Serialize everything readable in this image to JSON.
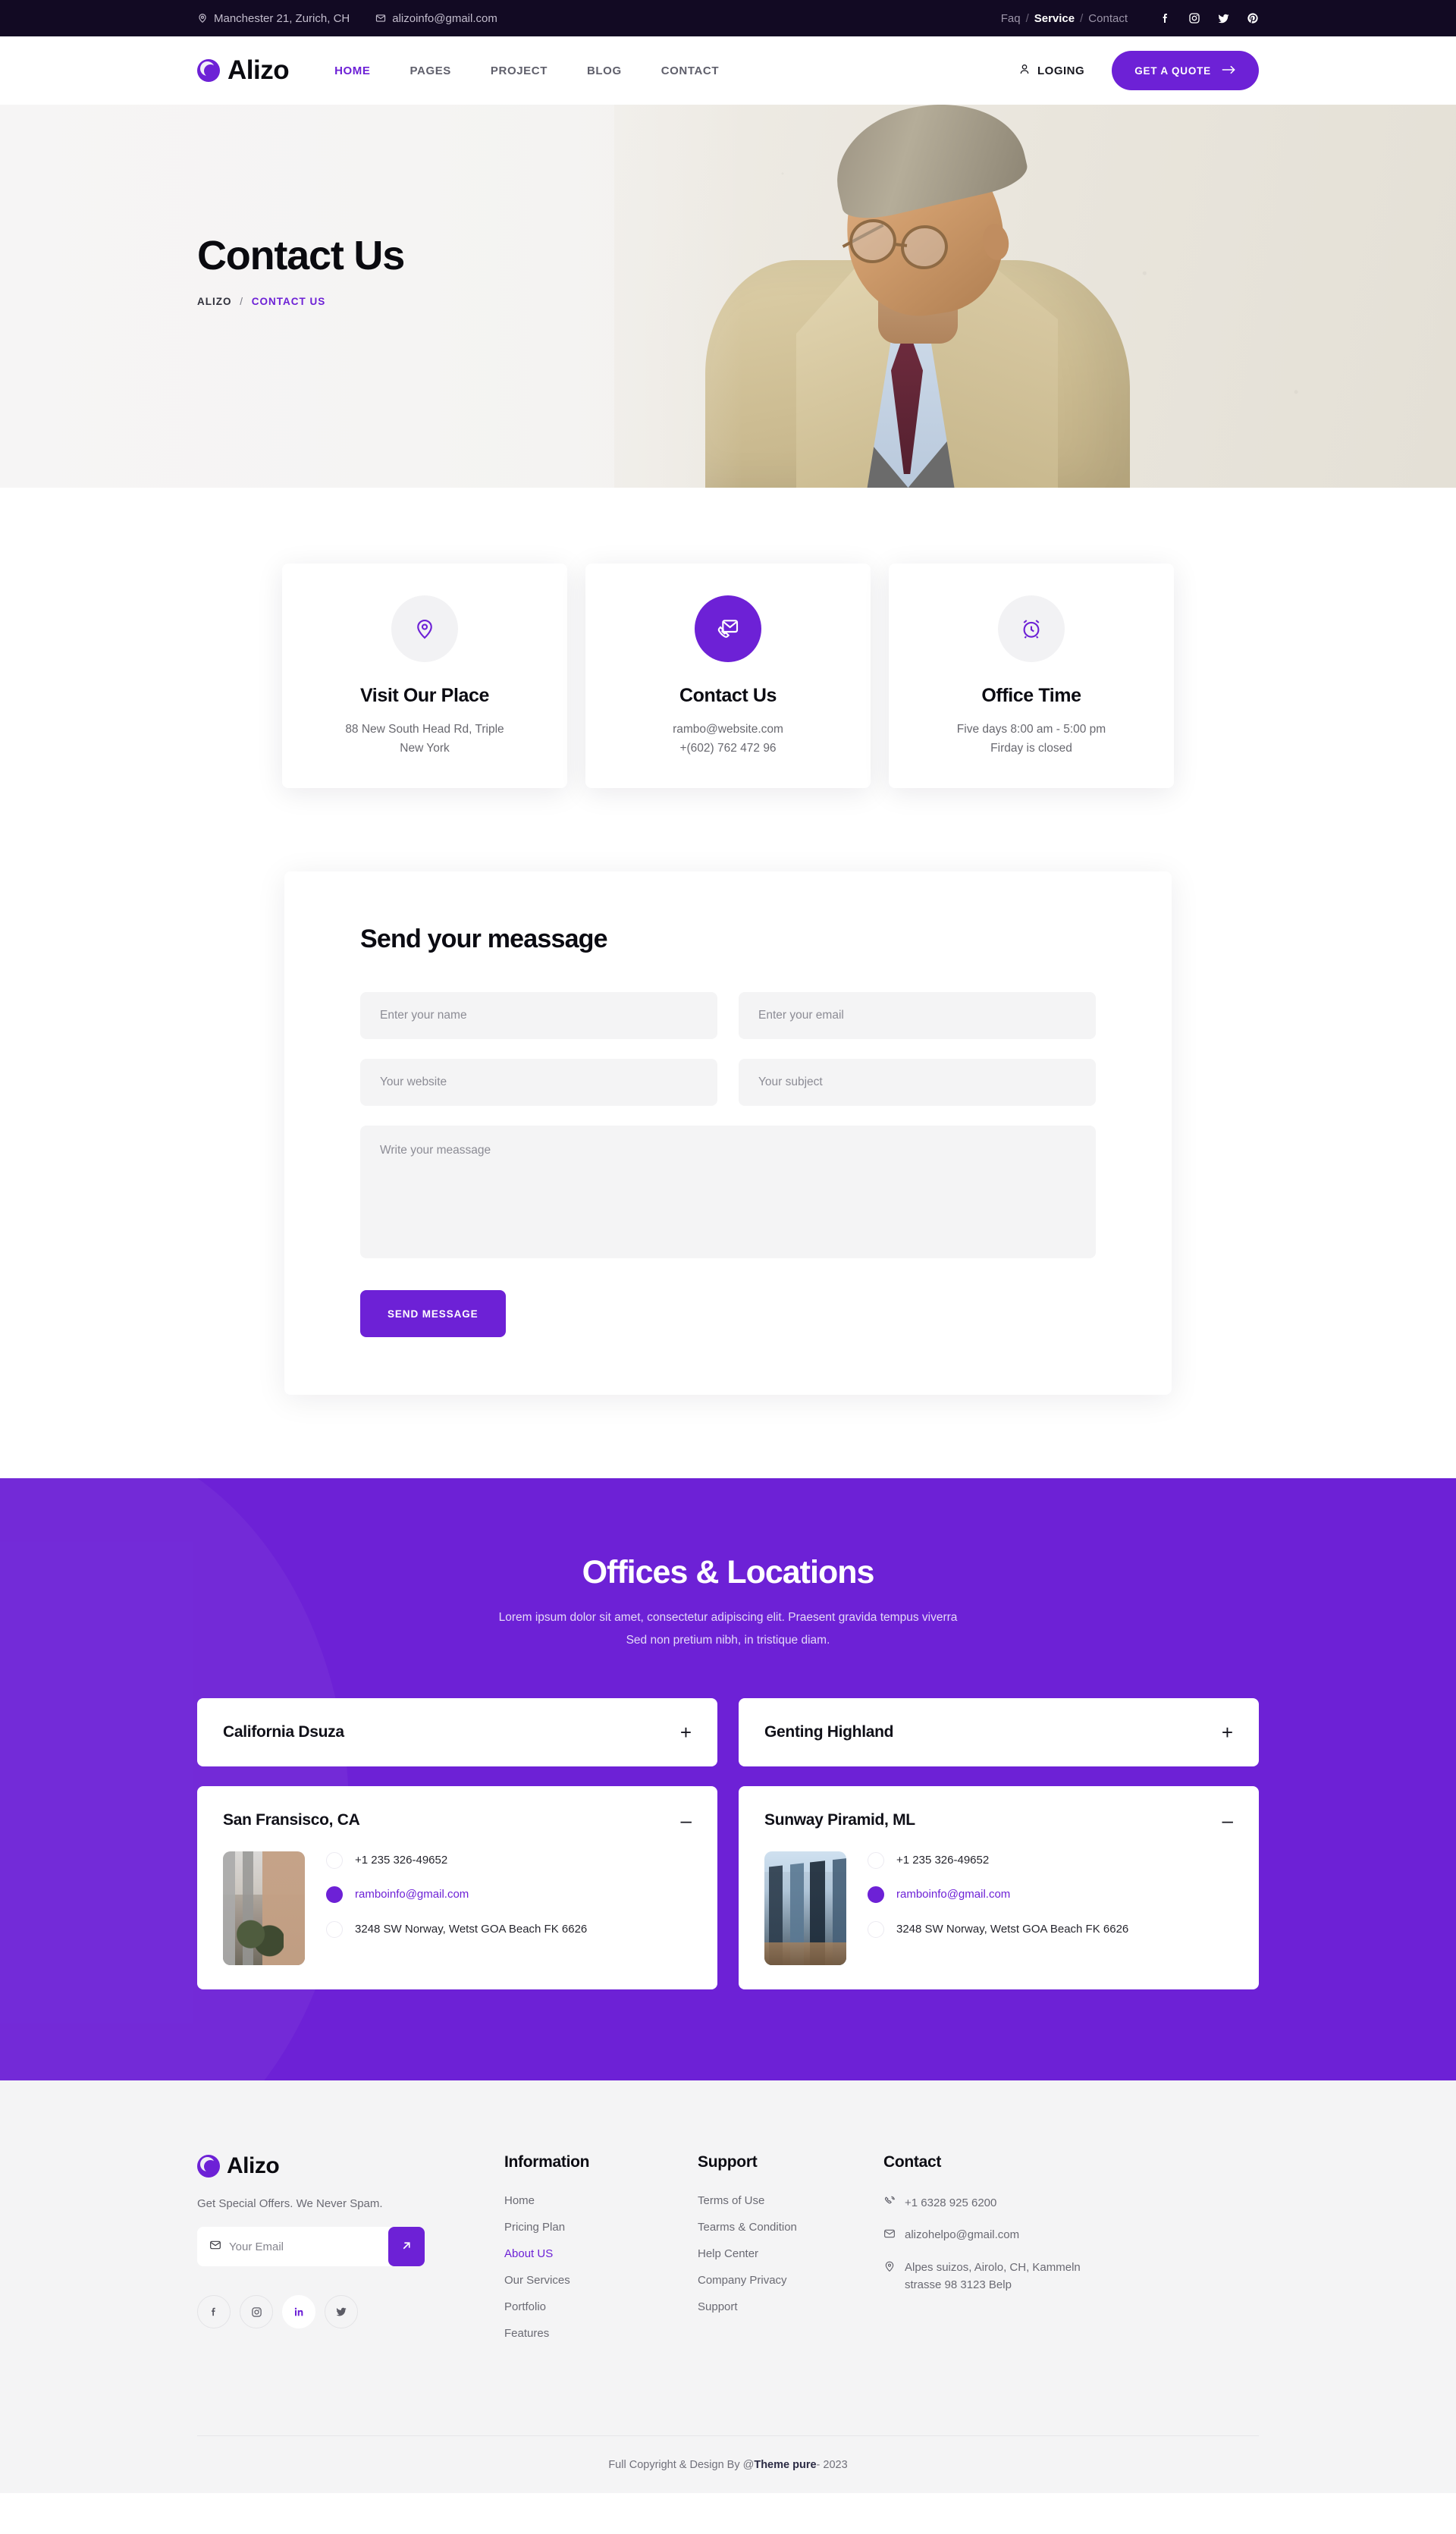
{
  "topbar": {
    "address": "Manchester 21, Zurich, CH",
    "email": "alizoinfo@gmail.com",
    "links": [
      {
        "label": "Faq",
        "active": false
      },
      {
        "label": "Service",
        "active": true
      },
      {
        "label": "Contact",
        "active": false
      }
    ],
    "social": [
      "facebook-icon",
      "instagram-icon",
      "twitter-icon",
      "pinterest-icon"
    ]
  },
  "header": {
    "brand": "Alizo",
    "nav": [
      {
        "label": "HOME",
        "active": true
      },
      {
        "label": "PAGES",
        "active": false
      },
      {
        "label": "PROJECT",
        "active": false
      },
      {
        "label": "BLOG",
        "active": false
      },
      {
        "label": "CONTACT",
        "active": false
      }
    ],
    "login_label": "LOGING",
    "quote_label": "GET A QUOTE"
  },
  "hero": {
    "title": "Contact Us",
    "breadcrumb_root": "ALIZO",
    "breadcrumb_sep": "/",
    "breadcrumb_current": "CONTACT US"
  },
  "info_cards": [
    {
      "icon": "map-pin-icon",
      "title": "Visit Our Place",
      "line1": "88 New South Head Rd, Triple",
      "line2": "New York",
      "filled": false
    },
    {
      "icon": "mail-phone-icon",
      "title": "Contact Us",
      "line1": "rambo@website.com",
      "line2": "+(602) 762 472 96",
      "filled": true
    },
    {
      "icon": "alarm-clock-icon",
      "title": "Office Time",
      "line1": "Five days 8:00 am -  5:00 pm",
      "line2": "Firday is closed",
      "filled": false
    }
  ],
  "form": {
    "title": "Send your meassage",
    "name_placeholder": "Enter your name",
    "email_placeholder": "Enter your email",
    "website_placeholder": "Your website",
    "subject_placeholder": "Your subject",
    "message_placeholder": "Write your meassage",
    "submit_label": "SEND MESSAGE"
  },
  "offices": {
    "title": "Offices & Locations",
    "desc_line1": "Lorem ipsum dolor sit amet, consectetur adipiscing elit. Praesent gravida tempus viverra",
    "desc_line2": "Sed non pretium nibh, in tristique diam.",
    "items": [
      {
        "title": "California Dsuza",
        "open": false,
        "sign": "+",
        "thumb": "sf"
      },
      {
        "title": "Genting Highland",
        "open": false,
        "sign": "+",
        "thumb": "kl"
      },
      {
        "title": "San Fransisco, CA",
        "open": true,
        "sign": "–",
        "thumb": "sf",
        "phone": "+1 235 326-49652",
        "email": "ramboinfo@gmail.com",
        "address": "3248 SW Norway, Wetst GOA Beach FK 6626"
      },
      {
        "title": "Sunway Piramid, ML",
        "open": true,
        "sign": "–",
        "thumb": "kl",
        "phone": "+1 235 326-49652",
        "email": "ramboinfo@gmail.com",
        "address": "3248 SW Norway, Wetst GOA Beach FK 6626"
      }
    ]
  },
  "footer": {
    "brand": "Alizo",
    "tagline": "Get Special Offers. We Never Spam.",
    "subscribe_placeholder": "Your Email",
    "social": [
      "facebook-icon",
      "instagram-icon",
      "linkedin-icon",
      "twitter-icon"
    ],
    "columns": [
      {
        "heading": "Information",
        "links": [
          {
            "label": "Home",
            "active": false
          },
          {
            "label": "Pricing Plan",
            "active": false
          },
          {
            "label": "About US",
            "active": true
          },
          {
            "label": "Our Services",
            "active": false
          },
          {
            "label": "Portfolio",
            "active": false
          },
          {
            "label": "Features",
            "active": false
          }
        ]
      },
      {
        "heading": "Support",
        "links": [
          {
            "label": "Terms of Use",
            "active": false
          },
          {
            "label": "Tearms & Condition",
            "active": false
          },
          {
            "label": "Help Center",
            "active": false
          },
          {
            "label": "Company Privacy",
            "active": false
          },
          {
            "label": "Support",
            "active": false
          }
        ]
      }
    ],
    "contact": {
      "heading": "Contact",
      "phone": "+1 6328 925 6200",
      "email": "alizohelpo@gmail.com",
      "address": "Alpes suizos, Airolo, CH, Kammeln strasse 98 3123 Belp"
    },
    "copyright_pre": "Full Copyright & Design By @",
    "copyright_brand": "Theme pure",
    "copyright_post": " - 2023"
  },
  "colors": {
    "accent": "#6d21d6",
    "dark": "#120a23",
    "light": "#f4f4f5"
  }
}
